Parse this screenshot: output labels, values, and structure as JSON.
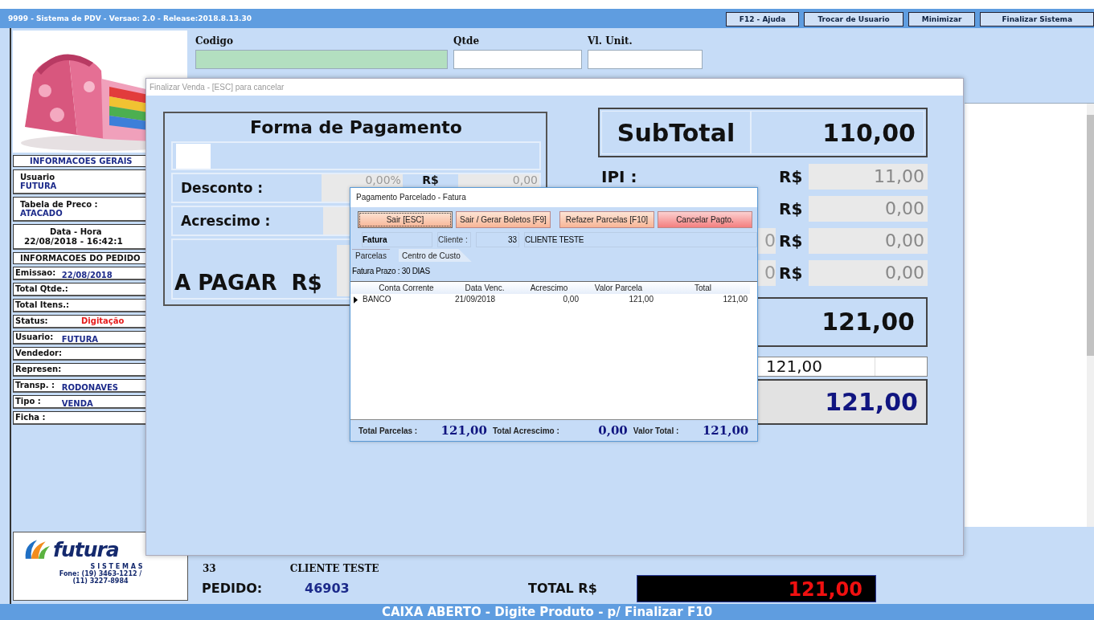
{
  "main_window": {
    "title": "9999 - Sistema de PDV - Versao: 2.0 - Release:2018.8.13.30",
    "title_buttons": [
      "F12 - Ajuda",
      "Trocar de Usuario",
      "Minimizar",
      "Finalizar Sistema"
    ],
    "product_image": {
      "kind": "picture"
    },
    "general_info": {
      "heading": "INFORMACOES GERAIS",
      "cards": [
        {
          "kind": "stacked",
          "label": "Usuario",
          "value": "FUTURA"
        },
        {
          "kind": "stacked",
          "label": "Tabela de Preco :",
          "value": "ATACADO"
        },
        {
          "kind": "centered",
          "label": "Data - Hora",
          "value": "22/08/2018 - 16:42:1"
        }
      ]
    },
    "order_info": {
      "heading": "INFORMACOES DO PEDIDO",
      "rows": [
        {
          "label": "Emissao:",
          "value": "22/08/2018",
          "kind": "info"
        },
        {
          "label": "Total Qtde.:"
        },
        {
          "label": "Total Itens.:"
        },
        {
          "label": "Status:",
          "value": "Digitação",
          "kind": "alert"
        },
        {
          "label": "Usuario:",
          "value": "FUTURA",
          "kind": "info"
        },
        {
          "label": "Vendedor:"
        },
        {
          "label": "Represen:"
        },
        {
          "label": "Transp. :",
          "value": "RODONAVES",
          "kind": "info"
        },
        {
          "label": "Tipo :",
          "value": "VENDA",
          "kind": "info"
        },
        {
          "label": "Ficha :"
        }
      ]
    },
    "logo": {
      "name": "futura",
      "tagline": "S I S T E M A S",
      "phone_lines": [
        "Fone: (19) 3463-1212 /",
        "(11) 3227-8984"
      ]
    },
    "entry_fields": [
      {
        "label": "Codigo",
        "focused": true
      },
      {
        "label": "Qtde",
        "focused": false
      },
      {
        "label": "Vl. Unit.",
        "focused": false
      }
    ],
    "client": {
      "code": "33",
      "name": "CLIENTE TESTE"
    },
    "order": {
      "label": "PEDIDO:",
      "number": "46903"
    },
    "total": {
      "label": "TOTAL R$",
      "value": "121,00"
    },
    "status_bar": "CAIXA ABERTO - Digite Produto - p/ Finalizar F10"
  },
  "dialog": {
    "title": "Finalizar Venda - [ESC] para cancelar",
    "payment": {
      "heading": "Forma de Pagamento",
      "discount": {
        "label": "Desconto :",
        "percent": "0,00%",
        "currency": "R$",
        "amount": "0,00"
      },
      "surcharge": {
        "label": "Acrescimo :"
      },
      "due": {
        "label": "A PAGAR",
        "currency": "R$"
      }
    },
    "subtotal": {
      "label": "SubTotal",
      "value": "110,00"
    },
    "tax_rows": [
      {
        "label": "IPI :",
        "currency": "R$",
        "value": "11,00"
      },
      {
        "currency": "R$",
        "value": "0,00"
      },
      {
        "prior": "0",
        "currency": "R$",
        "value": "0,00"
      },
      {
        "prior": "0",
        "currency": "R$",
        "value": "0,00"
      }
    ],
    "total": "121,00",
    "received": "121,00",
    "to_pay": "121,00"
  },
  "popup": {
    "title": "Pagamento Parcelado - Fatura",
    "buttons": [
      {
        "label": "Sair [ESC]",
        "kind": "normal",
        "focused": true
      },
      {
        "label": "Sair / Gerar Boletos [F9]",
        "kind": "normal",
        "focused": false
      },
      {
        "label": "Refazer Parcelas [F10]",
        "kind": "normal",
        "focused": false
      },
      {
        "label": "Cancelar Pagto.",
        "kind": "danger",
        "focused": false
      }
    ],
    "header": {
      "label": "Fatura",
      "client_label": "Cliente :",
      "client_code": "33",
      "client_name": "CLIENTE TESTE"
    },
    "tabs": [
      {
        "label": "Parcelas",
        "selected": true
      },
      {
        "label": "Centro de Custo",
        "selected": false
      }
    ],
    "term": "Fatura Prazo : 30 DIAS",
    "table": {
      "columns": [
        "Conta Corrente",
        "Data Venc.",
        "Acrescimo",
        "Valor Parcela",
        "Total"
      ],
      "rows": [
        {
          "current": true,
          "cells": [
            "BANCO",
            "21/09/2018",
            "0,00",
            "121,00",
            "121,00"
          ]
        }
      ]
    },
    "footer": [
      {
        "label": "Total Parcelas :",
        "value": "121,00"
      },
      {
        "label": "Total Acrescimo :",
        "value": "0,00"
      },
      {
        "label": "Valor Total :",
        "value": "121,00"
      }
    ]
  }
}
